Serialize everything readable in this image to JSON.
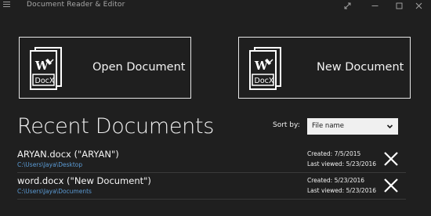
{
  "app": {
    "title": "Document Reader & Editor"
  },
  "tiles": [
    {
      "label": "Open Document",
      "icon": "docx-file-icon"
    },
    {
      "label": "New Document",
      "icon": "docx-file-icon"
    }
  ],
  "icon_text": {
    "letter": "W",
    "caption": "DocX"
  },
  "recent": {
    "heading": "Recent Documents",
    "sort_label": "Sort by:",
    "sort_value": "File name",
    "documents": [
      {
        "name": "ARYAN.docx (\"ARYAN\")",
        "path": "C:\\Users\\Jaya\\Desktop",
        "created": "Created: 7/5/2015",
        "viewed": "Last viewed: 5/23/2016"
      },
      {
        "name": "word.docx (\"New Document\")",
        "path": "C:\\Users\\Jaya\\Documents",
        "created": "Created: 5/23/2016",
        "viewed": "Last viewed: 5/23/2016"
      }
    ]
  },
  "colors": {
    "background": "#1f1f1f",
    "path_link": "#5b9bd5",
    "tile_border": "#e6e6e6"
  }
}
